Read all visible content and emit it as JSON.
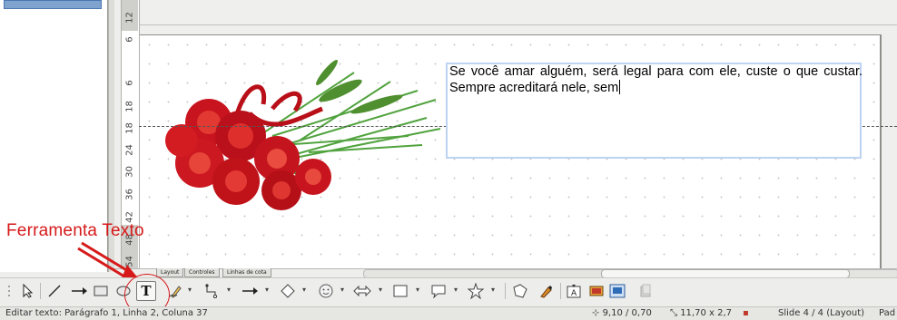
{
  "vertical_ruler": {
    "ticks": [
      "12",
      "6",
      "6",
      "18",
      "24",
      "30",
      "36",
      "42",
      "48",
      "54"
    ]
  },
  "slide": {
    "textbox_text": "Se você amar alguém, será legal para com ele, custe o que custar. Sempre acreditará nele, sem"
  },
  "annotation": {
    "label": "Ferramenta Texto",
    "color": "#d61a1a"
  },
  "tabs": [
    "Layout",
    "Controles",
    "Linhas de cota"
  ],
  "toolbar": {
    "text_tool_label": "T",
    "icons": [
      "select-icon",
      "line-icon",
      "arrow-line-icon",
      "rectangle-icon",
      "ellipse-icon",
      "text-icon",
      "curve-icon",
      "connector-icon",
      "lines-arrows-icon",
      "basic-shapes-icon",
      "symbol-shapes-icon",
      "block-arrows-icon",
      "flowchart-icon",
      "callouts-icon",
      "stars-icon",
      "points-icon",
      "fontwork-icon",
      "from-file-icon",
      "gallery-icon",
      "extrusion-icon"
    ]
  },
  "statusbar": {
    "edit_info": "Editar texto: Parágrafo 1, Linha 2, Coluna 37",
    "position": "9,10 / 0,70",
    "size": "11,70 x 2,7",
    "slide_info": "Slide 4 / 4 (Layout)",
    "master": "Pad"
  },
  "colors": {
    "accent": "#bcd3f2",
    "rose_red": "#c8141e",
    "leaf_green": "#3f9a2a"
  }
}
